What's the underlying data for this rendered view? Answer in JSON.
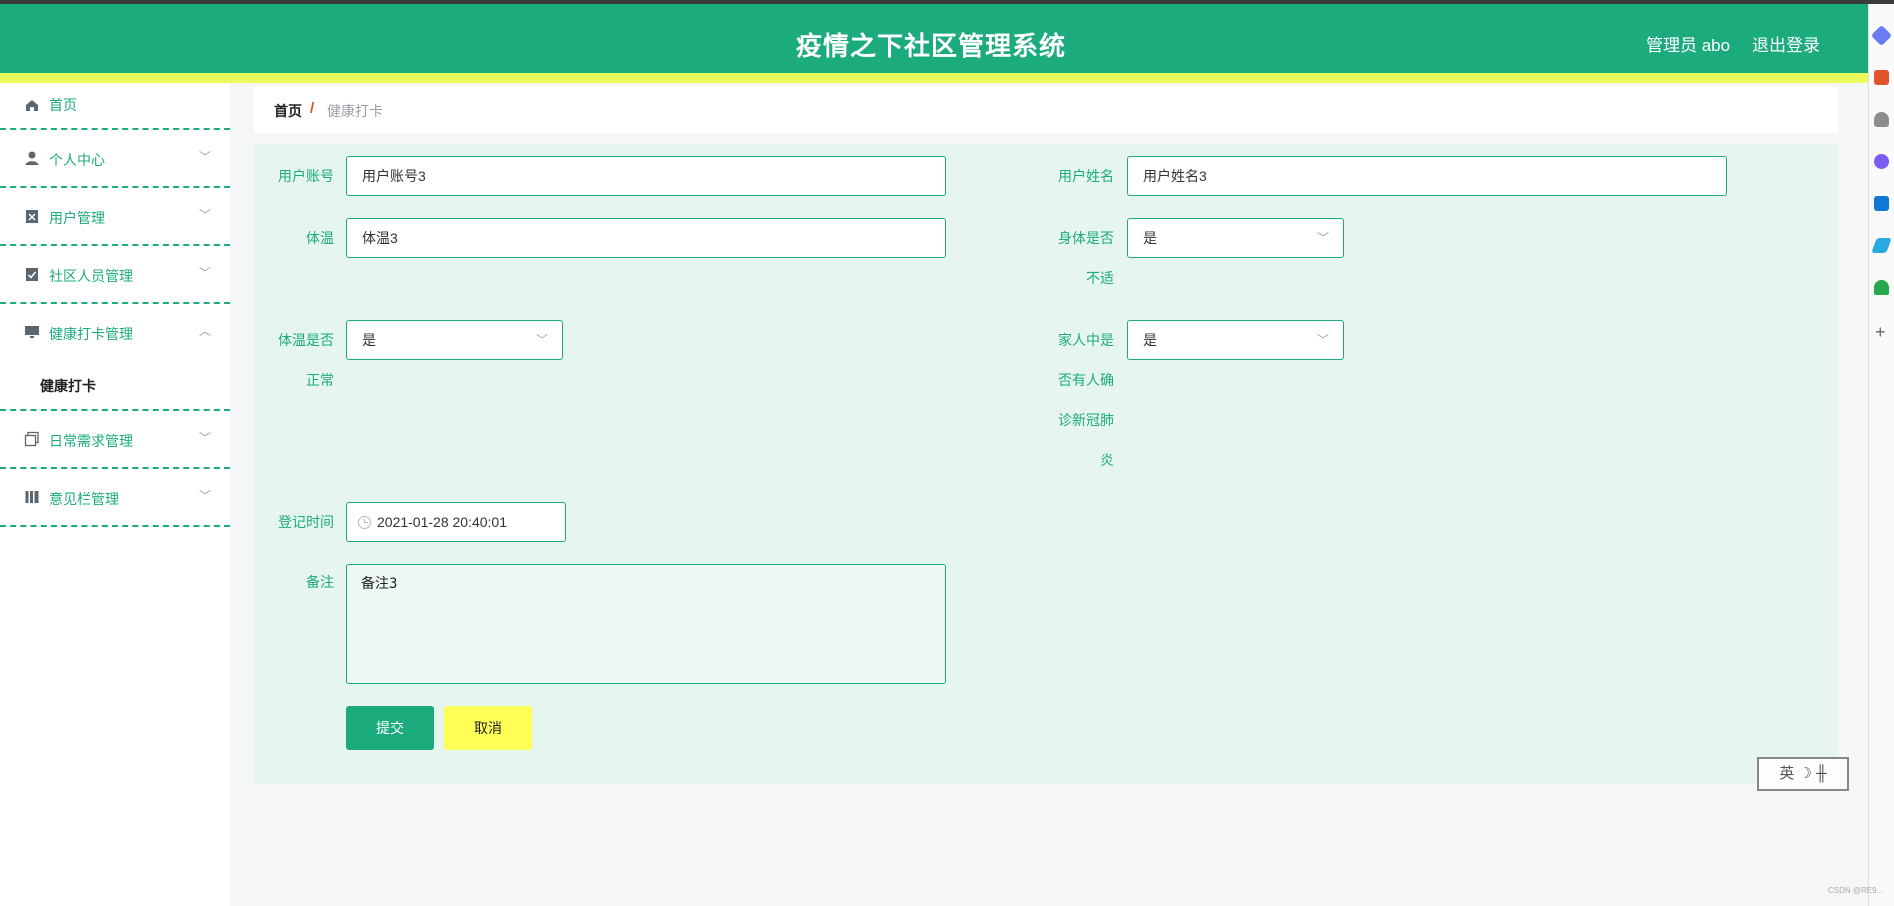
{
  "header": {
    "title": "疫情之下社区管理系统",
    "admin_label": "管理员 abo",
    "logout": "退出登录",
    "colors": {
      "primary": "#1bab7c",
      "stripe": "#ecfb5c"
    }
  },
  "sidebar": {
    "items": [
      {
        "label": "首页",
        "icon": "home-icon"
      },
      {
        "label": "个人中心",
        "icon": "user-icon"
      },
      {
        "label": "用户管理",
        "icon": "clipboard-x-icon"
      },
      {
        "label": "社区人员管理",
        "icon": "clipboard-check-icon"
      },
      {
        "label": "健康打卡管理",
        "icon": "monitor-icon"
      },
      {
        "label": "日常需求管理",
        "icon": "copy-icon"
      },
      {
        "label": "意见栏管理",
        "icon": "book-icon"
      }
    ],
    "sub_item": "健康打卡"
  },
  "breadcrumb": {
    "home": "首页",
    "separator": "/",
    "current": "健康打卡"
  },
  "form": {
    "account_label": "用户账号",
    "account_value": "用户账号3",
    "name_label": "用户姓名",
    "name_value": "用户姓名3",
    "temp_label": "体温",
    "temp_value": "体温3",
    "unwell_label_1": "身体是否",
    "unwell_label_2": "不适",
    "unwell_value": "是",
    "temp_normal_label_1": "体温是否",
    "temp_normal_label_2": "正常",
    "temp_normal_value": "是",
    "family_label_1": "家人中是",
    "family_label_2": "否有人确",
    "family_label_3": "诊新冠肺",
    "family_label_4": "炎",
    "family_value": "是",
    "time_label": "登记时间",
    "time_value": "2021-01-28 20:40:01",
    "note_label": "备注",
    "note_value": "备注3",
    "submit": "提交",
    "cancel": "取消"
  },
  "ime": {
    "label": "英 ☽ ╫"
  },
  "watermark": "CSDN @RE9..."
}
